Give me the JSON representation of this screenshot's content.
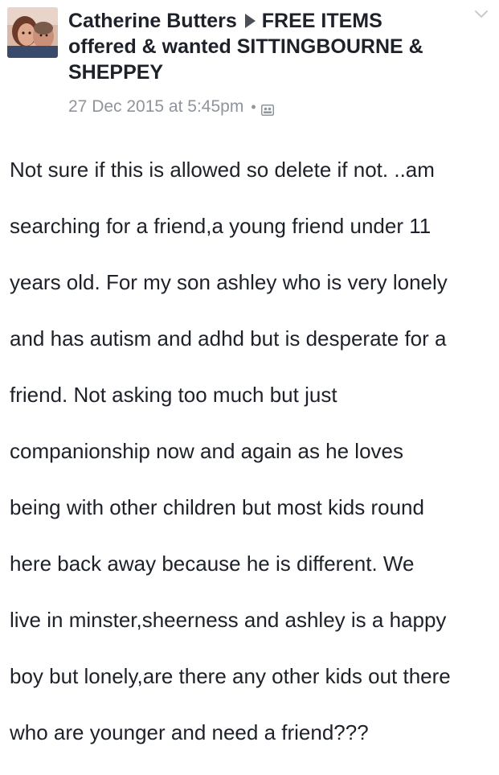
{
  "post": {
    "author": "Catherine Butters",
    "group": "FREE ITEMS offered & wanted SITTINGBOURNE & SHEPPEY",
    "timestamp": "27 Dec 2015 at 5:45pm",
    "separator": "•",
    "body_lines": [
      "Not sure if this is allowed so delete if not. ..am",
      "searching for a friend,a young friend under 11",
      "years old. For my son ashley who is very lonely",
      "and has autism and adhd but is desperate for a",
      "friend.  Not asking too much but just",
      "companionship now and again as he loves",
      "being with other children but most kids round",
      "here back away because he is different.   We",
      "live in minster,sheerness and ashley is a happy",
      "boy but lonely,are there any other kids out there",
      "who are younger and need a friend???"
    ]
  },
  "icons": {
    "avatar": "profile-photo",
    "arrow": "triangle-right-icon",
    "privacy": "group-privacy-icon",
    "chevron": "chevron-down-icon"
  },
  "colors": {
    "text": "#1d2129",
    "meta": "#90949c",
    "arrow": "#4b4f56",
    "chevron": "#c8cbd0"
  }
}
